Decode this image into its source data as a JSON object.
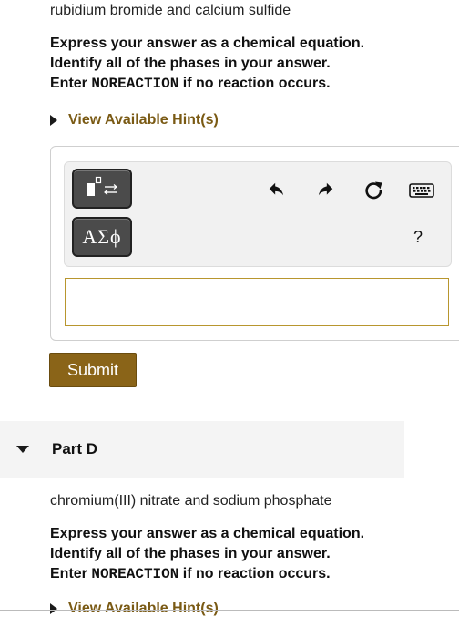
{
  "part_c": {
    "problem": "rubidium bromide and calcium sulfide",
    "instr_line1": "Express your answer as a chemical equation.",
    "instr_line2": "Identify all of the phases in your answer.",
    "instr_line3_pre": "Enter ",
    "instr_line3_code": "NOREACTION",
    "instr_line3_post": " if no reaction occurs.",
    "hint_label": "View Available Hint(s)",
    "greek_button_label": "ΑΣϕ",
    "help_label": "?",
    "answer_value": "",
    "submit_label": "Submit"
  },
  "part_d": {
    "title": "Part D",
    "problem": "chromium(III) nitrate and sodium phosphate",
    "instr_line1": "Express your answer as a chemical equation.",
    "instr_line2": "Identify all of the phases in your answer.",
    "instr_line3_pre": "Enter ",
    "instr_line3_code": "NOREACTION",
    "instr_line3_post": " if no reaction occurs.",
    "hint_label": "View Available Hint(s)"
  },
  "icons": [
    "templates-icon",
    "undo-icon",
    "redo-icon",
    "reset-icon",
    "keyboard-icon",
    "caret-right-icon",
    "caret-down-icon"
  ],
  "colors": {
    "accent": "#8a6418",
    "hint_text": "#7a5a14",
    "answer_border": "#b8962e",
    "toolbar_button": "#4b4b4b"
  }
}
